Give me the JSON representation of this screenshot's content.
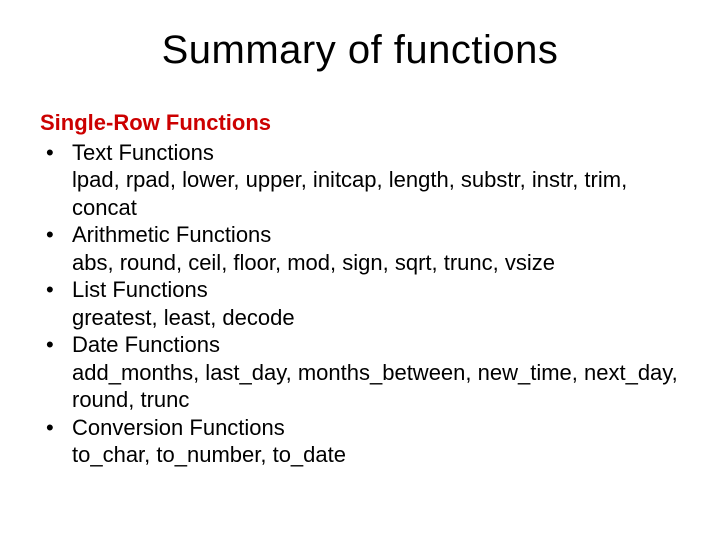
{
  "title": "Summary of functions",
  "section_header": "Single-Row Functions",
  "items": [
    {
      "title": "Text Functions",
      "details": "lpad, rpad, lower, upper, initcap, length, substr, instr, trim, concat"
    },
    {
      "title": "Arithmetic Functions",
      "details": "abs, round, ceil, floor, mod, sign, sqrt, trunc, vsize"
    },
    {
      "title": "List Functions",
      "details": "greatest, least, decode"
    },
    {
      "title": "Date Functions",
      "details": "add_months, last_day, months_between, new_time, next_day, round, trunc"
    },
    {
      "title": "Conversion Functions",
      "details": "to_char, to_number, to_date"
    }
  ]
}
